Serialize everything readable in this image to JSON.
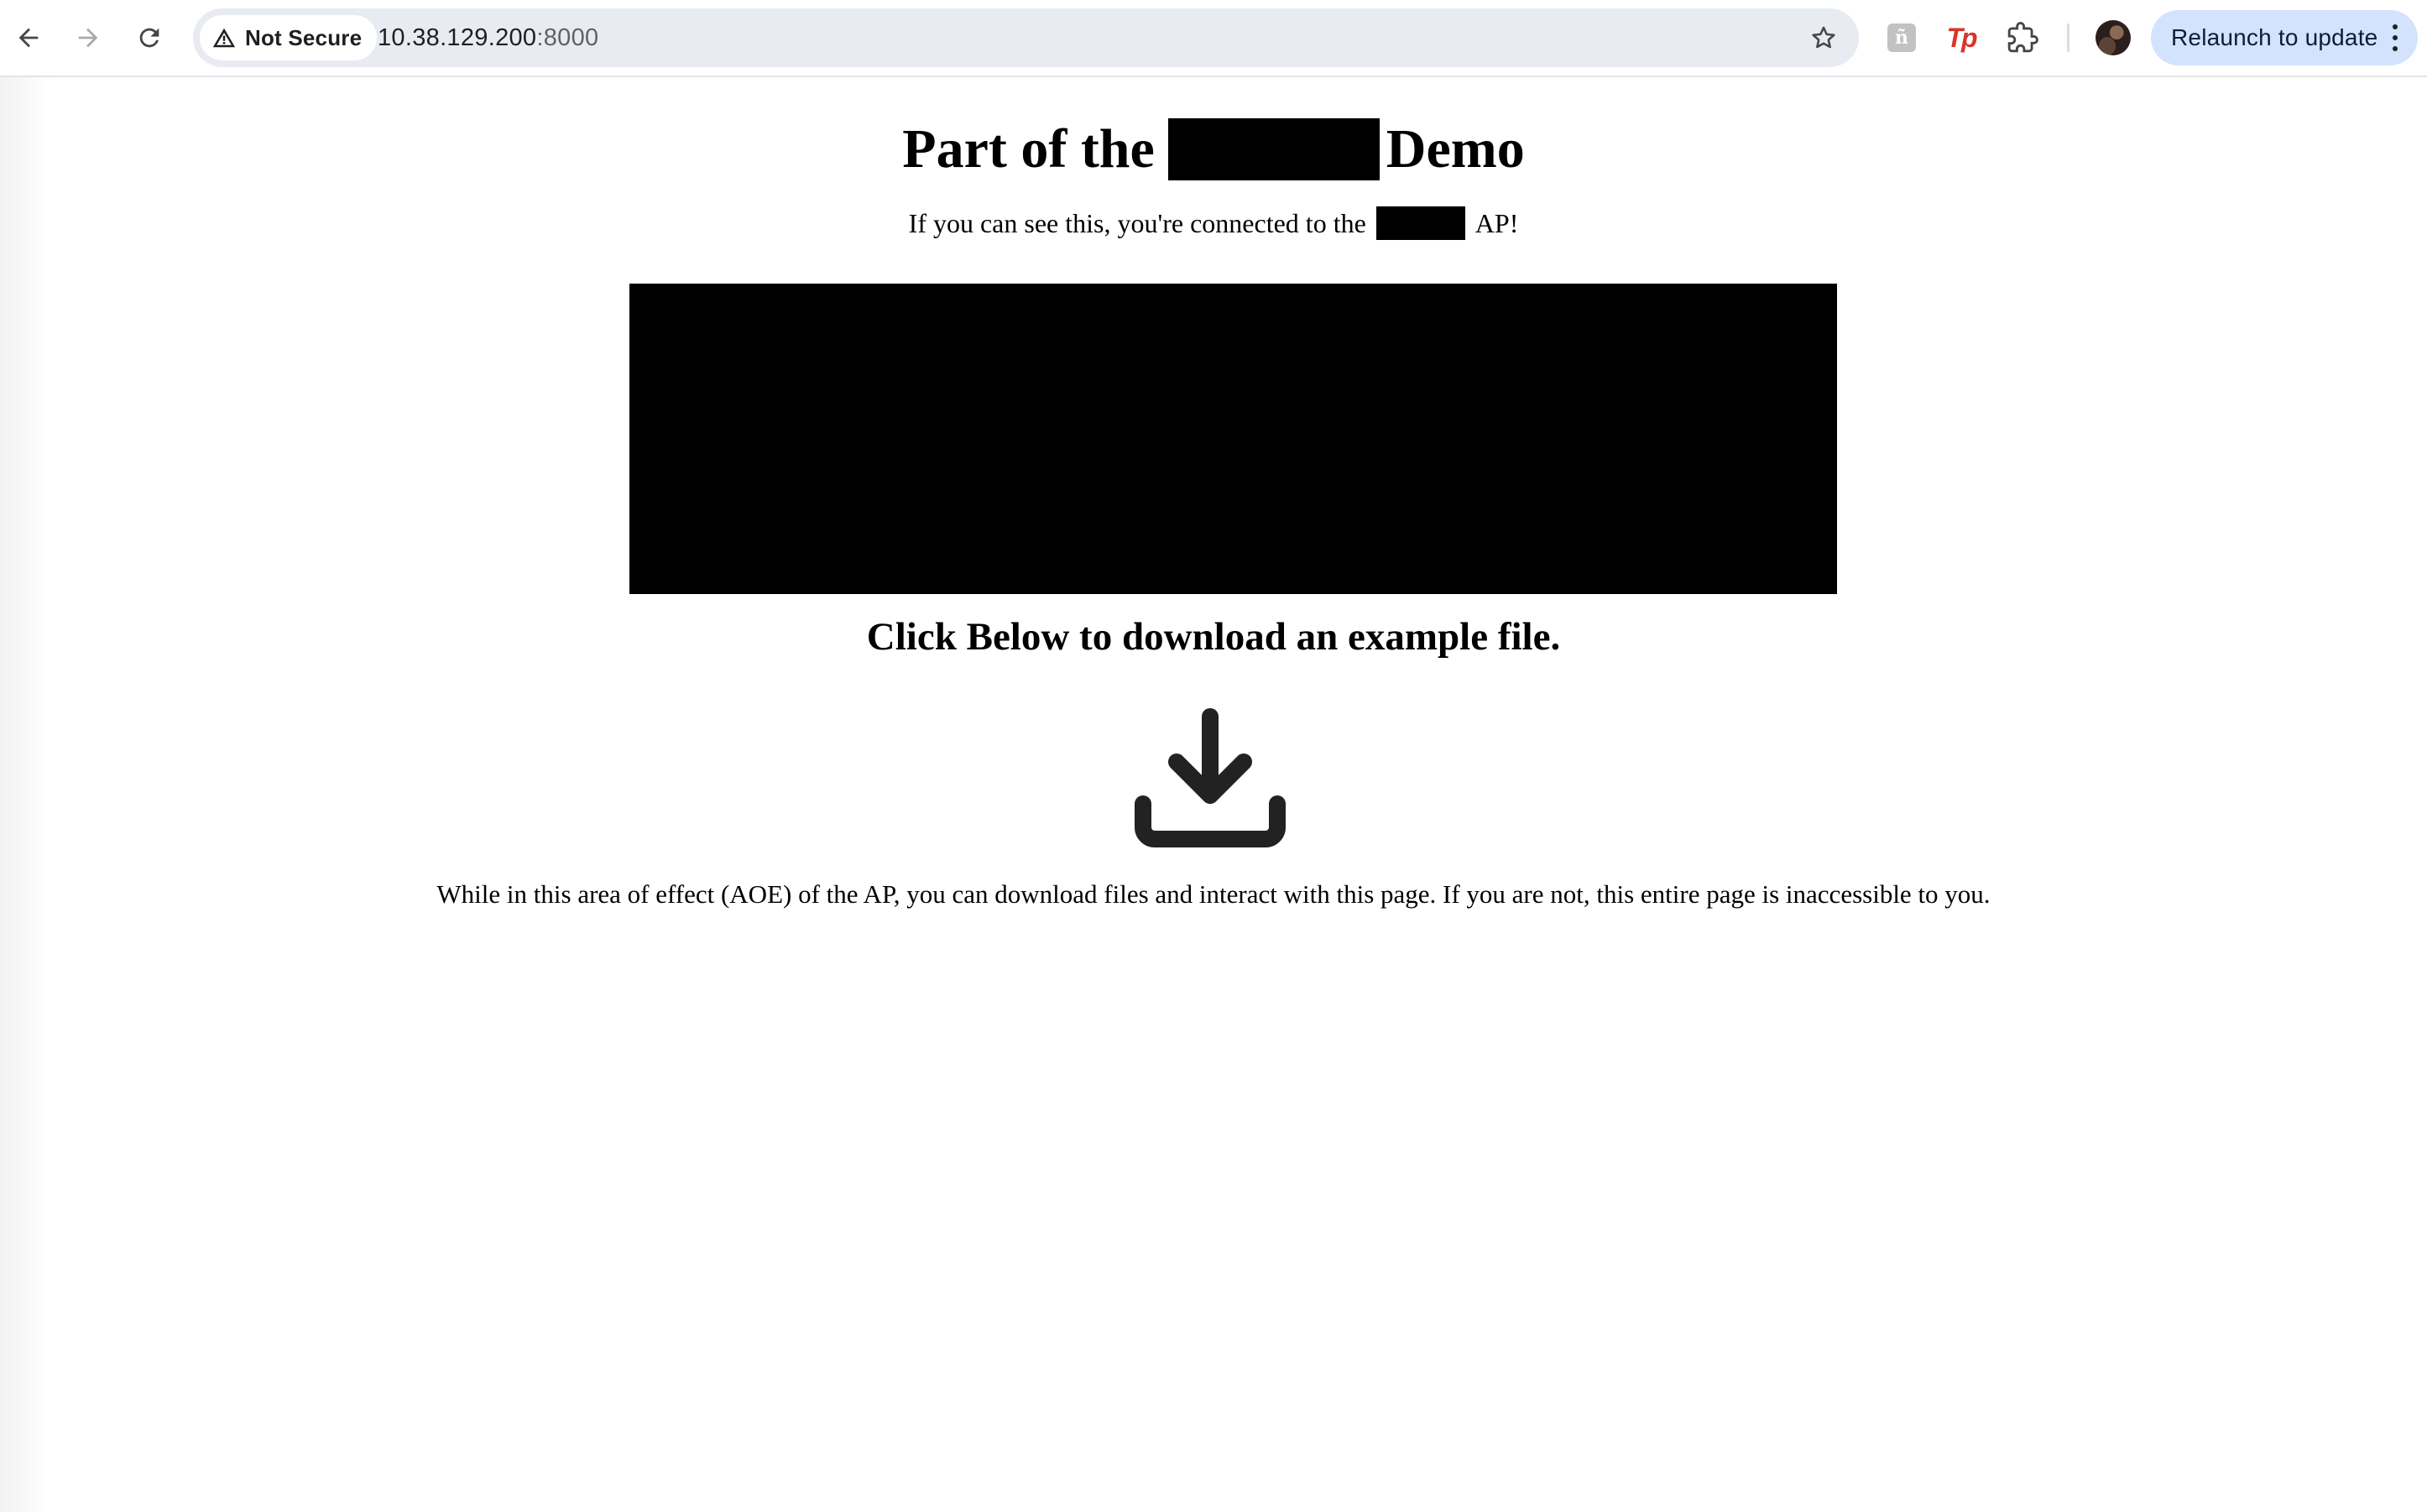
{
  "browser": {
    "security_label": "Not Secure",
    "url_host": "10.38.129.200",
    "url_port": ":8000",
    "extension_gray_glyph": "ñ",
    "extension_tp_label": "Tp",
    "relaunch_label": "Relaunch to update",
    "icons": [
      "back-arrow-icon",
      "forward-arrow-icon",
      "reload-icon",
      "warning-icon",
      "star-icon",
      "extensions-puzzle-icon",
      "kebab-menu-icon"
    ]
  },
  "page": {
    "title_prefix": "Part of the",
    "title_suffix": "Demo",
    "subtitle_prefix": "If you can see this, you're connected to the",
    "subtitle_suffix": "AP!",
    "cta_heading": "Click Below to download an example file.",
    "note": "While in this area of effect (AOE) of the AP, you can download files and interact with this page. If you are not, this entire page is inaccessible to you."
  },
  "colors": {
    "omnibox_bg": "#e9ebf2",
    "relaunch_bg": "#d3e3fd",
    "redaction": "#000000",
    "download_icon": "#222222"
  }
}
